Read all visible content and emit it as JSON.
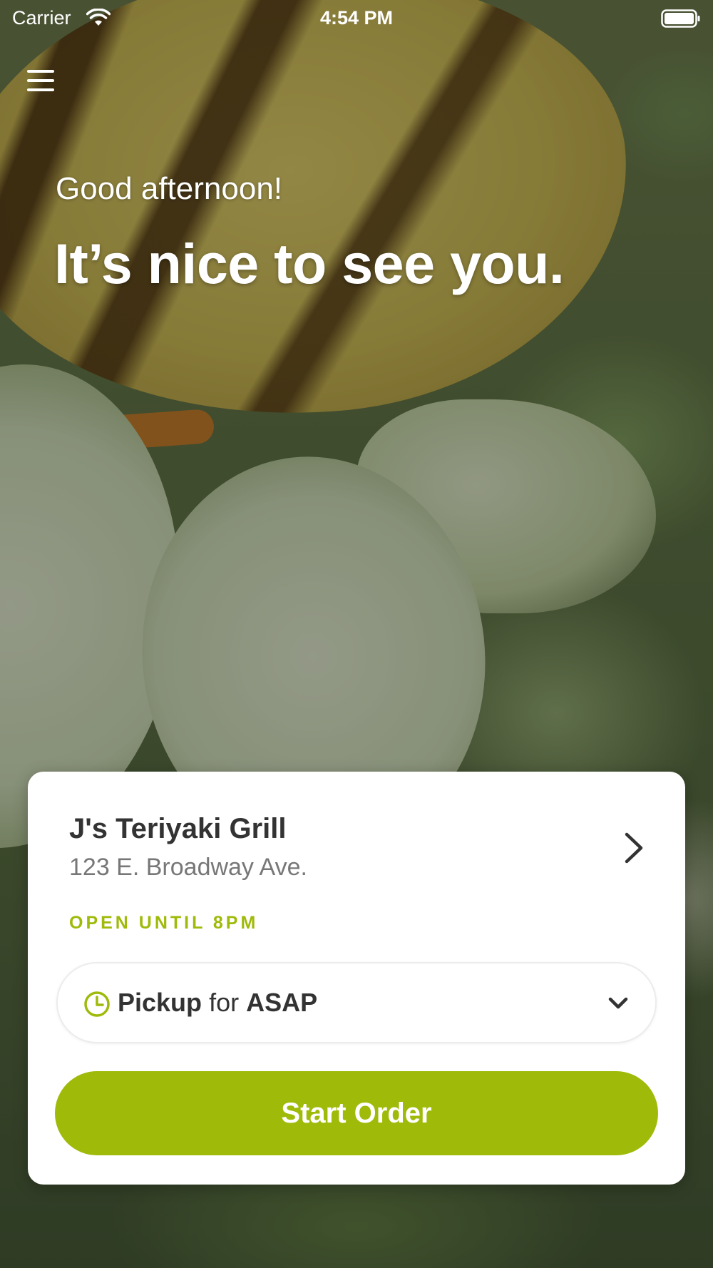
{
  "status_bar": {
    "carrier": "Carrier",
    "time": "4:54 PM",
    "icons": [
      "wifi-icon",
      "battery-icon"
    ]
  },
  "header": {
    "menu_icon": "hamburger-menu-icon"
  },
  "greeting": {
    "salutation": "Good afternoon!",
    "headline": "It’s nice to see you."
  },
  "location_card": {
    "name": "J's Teriyaki Grill",
    "address": "123 E. Broadway Ave.",
    "hours": "OPEN UNTIL 8PM",
    "order_mode": {
      "icon": "clock-icon",
      "method": "Pickup",
      "connector": "for",
      "time": "ASAP"
    },
    "start_order_label": "Start Order"
  },
  "colors": {
    "accent": "#a0ba0a",
    "card_background": "#ffffff",
    "primary_text": "#333333",
    "secondary_text": "#777777"
  }
}
